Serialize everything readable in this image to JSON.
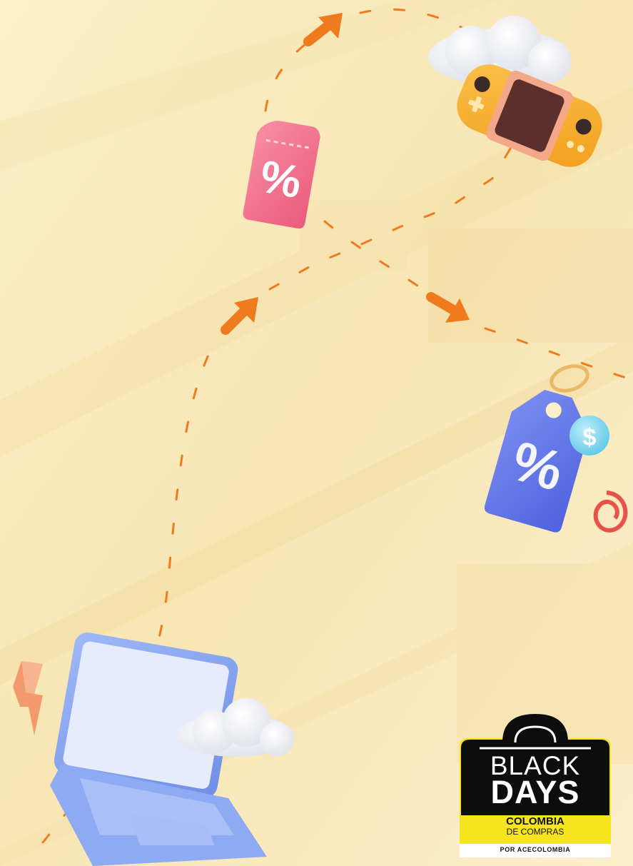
{
  "badge": {
    "line1": "BLACK",
    "line2": "DAYS",
    "line3": "COLOMBIA",
    "line4": "DE COMPRAS",
    "line5": "POR ACECOLOMBIA"
  },
  "icons": {
    "ticket": "percent",
    "price_tag": "percent",
    "coin": "$"
  },
  "colors": {
    "background": "#fbefc6",
    "accent": "#f07a1e",
    "badge_black": "#0d0d0d",
    "badge_yellow": "#f6e51c"
  }
}
